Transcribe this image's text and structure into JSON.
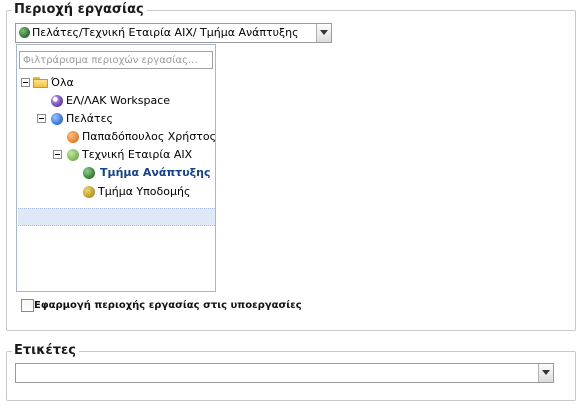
{
  "work_area": {
    "legend": "Περιοχή εργασίας",
    "selected_value": "Πελάτες/Τεχνική Εταιρία ΑΙΧ/ Τμήμα Ανάπτυξης",
    "selected_icon": "green-circle-icon",
    "filter_placeholder": "Φιλτράρισμα περιοχών εργασίας...",
    "tree": {
      "root": {
        "label": "Όλα",
        "icon": "folder-icon"
      },
      "workspace": {
        "label": "ΕΛ/ΛΑΚ Workspace",
        "icon": "purple-circle-icon",
        "color": "#7b4bb3"
      },
      "clients": {
        "label": "Πελάτες",
        "icon": "blue-circle-icon",
        "color": "#2d6fd6"
      },
      "papadopoulos": {
        "label": "Παπαδόπουλος Χρήστος",
        "icon": "orange-circle-icon",
        "color": "#e07a24"
      },
      "company": {
        "label": "Τεχνική Εταιρία ΑΙΧ",
        "icon": "lightgreen-circle-icon",
        "color": "#76b04c"
      },
      "dev_dept": {
        "label": "Τμήμα Ανάπτυξης",
        "icon": "green-circle-icon",
        "color": "#2f7a2f",
        "selected": true
      },
      "infra_dept": {
        "label": "Τμήμα Υποδομής",
        "icon": "olive-circle-icon",
        "color": "#b8941c"
      }
    },
    "apply_subtasks_label": "Εφαρμογή περιοχής εργασίας στις υποεργασίες",
    "apply_subtasks_checked": false
  },
  "tags": {
    "legend": "Ετικέτες",
    "value": ""
  },
  "colors": {
    "border": "#c9c9c9",
    "selection_bg": "#dfe8f6",
    "selection_text": "#15428b"
  }
}
